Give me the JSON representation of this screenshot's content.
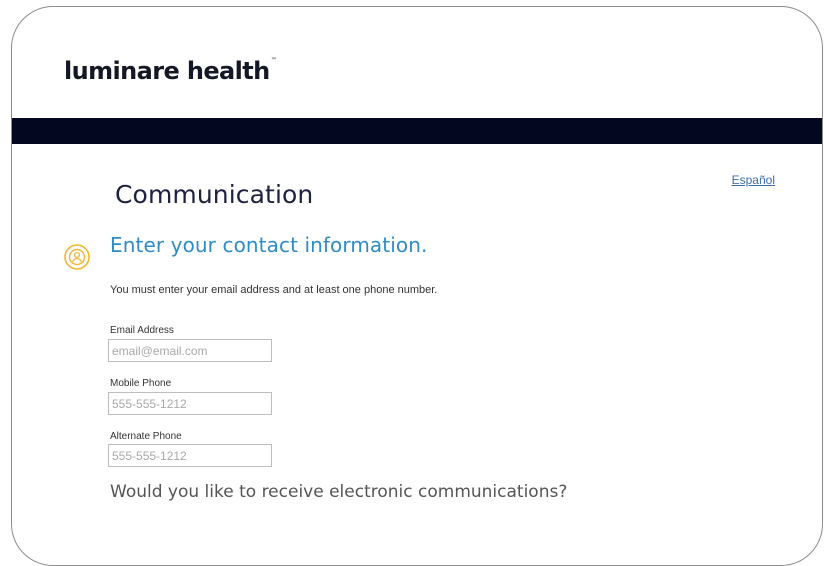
{
  "header": {
    "logo_text": "luminare health",
    "logo_trademark": "™"
  },
  "language_link": "Español",
  "page_title": "Communication",
  "section": {
    "icon": "person-circle-icon",
    "heading": "Enter your contact information.",
    "instructions": "You must enter your email address and at least one phone number."
  },
  "form": {
    "email": {
      "label": "Email Address",
      "placeholder": "email@email.com",
      "value": ""
    },
    "mobile": {
      "label": "Mobile Phone",
      "placeholder": "555-555-1212",
      "value": ""
    },
    "alternate": {
      "label": "Alternate Phone",
      "placeholder": "555-555-1212",
      "value": ""
    }
  },
  "question": "Would you like to receive electronic communications?",
  "colors": {
    "nav_bar": "#03071f",
    "heading_blue": "#2f8cc7",
    "icon_gold": "#f2b632",
    "link_blue": "#3b6ea8"
  }
}
